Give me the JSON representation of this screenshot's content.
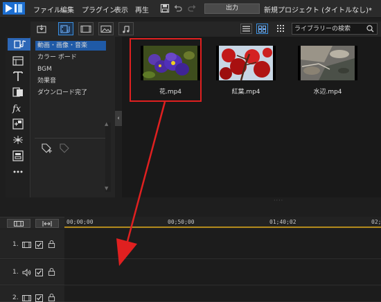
{
  "menu": {
    "items": [
      "ファイル",
      "編集",
      "プラグイン",
      "表示",
      "再生"
    ],
    "output_label": "出力",
    "project_title": "新規プロジェクト (タイトルなし)*"
  },
  "library": {
    "search": {
      "placeholder": "ライブラリーの検索"
    }
  },
  "categories": {
    "items": [
      "動画・画像・音楽",
      "カラー ボード",
      "BGM",
      "効果音",
      "ダウンロード完了"
    ],
    "selected_index": 0
  },
  "media": {
    "items": [
      {
        "label": "花.mp4"
      },
      {
        "label": "紅葉.mp4"
      },
      {
        "label": "水辺.mp4"
      }
    ]
  },
  "timeline": {
    "ruler": [
      "00;00;00",
      "00;50;00",
      "01;40;02",
      "02;"
    ],
    "tracks": [
      {
        "num": "1.",
        "type": "video"
      },
      {
        "num": "1.",
        "type": "audio"
      },
      {
        "num": "2.",
        "type": "video"
      }
    ]
  },
  "annotation": {
    "color": "#e02020"
  }
}
